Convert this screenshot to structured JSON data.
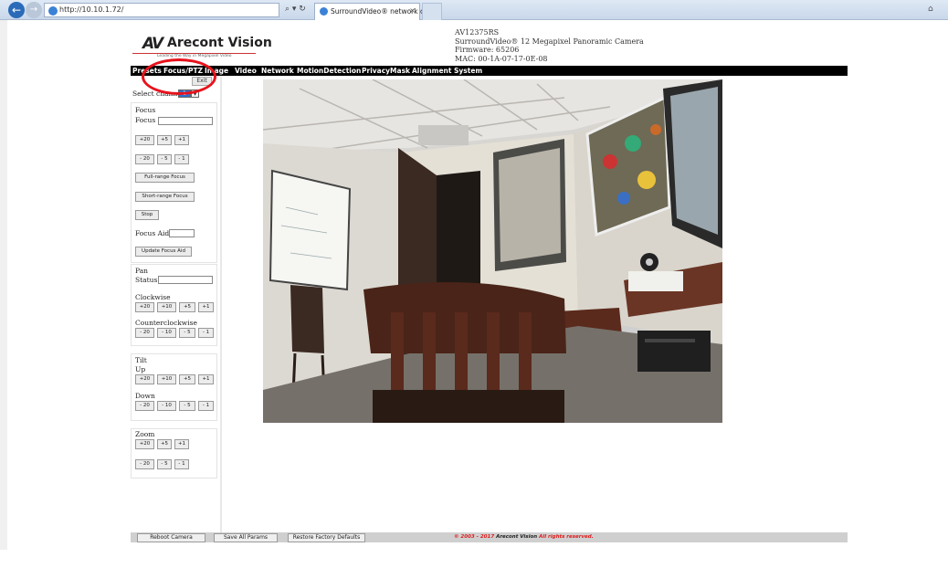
{
  "browser": {
    "address": "http://10.10.1.72/",
    "search_refresh": "⌕ ▾ ↻",
    "tab_title": "SurroundVideo® network c...",
    "tab_close": "×"
  },
  "header": {
    "brand": "Arecont Vision",
    "tagline": "Leading the Way in Megapixel Video",
    "model": "AV12375RS",
    "product": "SurroundVideo® 12 Megapixel Panoramic Camera",
    "firmware": "Firmware: 65206",
    "mac": "MAC: 00-1A-07-17-0E-08"
  },
  "menu": {
    "items": [
      "Presets",
      "Focus/PTZ",
      "Image",
      "Video",
      "Network",
      "MotionDetection",
      "PrivacyMask",
      "Alignment",
      "System"
    ]
  },
  "sidebar": {
    "exit_label": "Exit",
    "select_channel_label": "Select channel",
    "channel_value": "1",
    "focus": {
      "title": "Focus",
      "field_label": "Focus :",
      "row1": [
        "+20",
        "+5",
        "+1"
      ],
      "row2": [
        "- 20",
        "- 5",
        "- 1"
      ],
      "full_range": "Full-range Focus",
      "short_range": "Short-range Focus",
      "stop": "Stop",
      "aid_label": "Focus Aid:",
      "update_aid": "Update Focus Aid"
    },
    "pan": {
      "title": "Pan",
      "status_label": "Status :",
      "clockwise": "Clockwise",
      "cw_buttons": [
        "+20",
        "+10",
        "+5",
        "+1"
      ],
      "counterclockwise": "Counterclockwise",
      "ccw_buttons": [
        "- 20",
        "- 10",
        "- 5",
        "- 1"
      ]
    },
    "tilt": {
      "title": "Tilt",
      "up": "Up",
      "up_buttons": [
        "+20",
        "+10",
        "+5",
        "+1"
      ],
      "down": "Down",
      "down_buttons": [
        "- 20",
        "- 10",
        "- 5",
        "- 1"
      ]
    },
    "zoom": {
      "title": "Zoom",
      "row1": [
        "+20",
        "+5",
        "+1"
      ],
      "row2": [
        "- 20",
        "- 5",
        "- 1"
      ]
    }
  },
  "footer": {
    "reboot": "Reboot Camera",
    "save": "Save All Params",
    "restore": "Restore Factory Defaults",
    "copyright_prefix": "© 2003 - 2017 ",
    "copyright_brand": "Arecont Vision",
    "copyright_suffix": " All rights reserved."
  },
  "colors": {
    "menu_bg": "#000000",
    "highlight_circle": "#e8121c",
    "channel_select": "#2e6fd0"
  }
}
